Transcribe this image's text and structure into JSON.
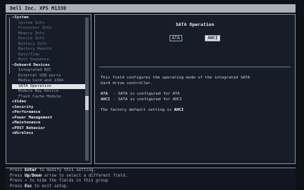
{
  "window": {
    "title": "Dell Inc. XPS M1330"
  },
  "menu": [
    {
      "label": "System",
      "kind": "cat"
    },
    {
      "label": "System Info",
      "kind": "sub"
    },
    {
      "label": "Processor Info",
      "kind": "sub"
    },
    {
      "label": "Memory Info",
      "kind": "sub"
    },
    {
      "label": "Device Info",
      "kind": "sub"
    },
    {
      "label": "Battery Info",
      "kind": "sub"
    },
    {
      "label": "Battery Health",
      "kind": "sub"
    },
    {
      "label": "Date/Time",
      "kind": "sub"
    },
    {
      "label": "Boot Sequence",
      "kind": "sub"
    },
    {
      "label": "Onboard Devices",
      "kind": "cat"
    },
    {
      "label": "Integrated NIC",
      "kind": "sub"
    },
    {
      "label": "External USB ports",
      "kind": "sub"
    },
    {
      "label": "Media Card and 1394",
      "kind": "sub"
    },
    {
      "label": "SATA Operation",
      "kind": "sub",
      "selected": true
    },
    {
      "label": "Module Bay Device",
      "kind": "sub"
    },
    {
      "label": "Flash Cache Module",
      "kind": "sub"
    },
    {
      "label": "Video",
      "kind": "cat"
    },
    {
      "label": "Security",
      "kind": "cat"
    },
    {
      "label": "Performance",
      "kind": "cat"
    },
    {
      "label": "Power Management",
      "kind": "cat"
    },
    {
      "label": "Maintenance",
      "kind": "cat"
    },
    {
      "label": "POST Behavior",
      "kind": "cat"
    },
    {
      "label": "Wireless",
      "kind": "cat"
    }
  ],
  "detail": {
    "title": "SATA Operation",
    "options": [
      {
        "label": "ATA",
        "active": false
      },
      {
        "label": "AHCI",
        "active": true
      }
    ],
    "description_line1": "This field configures the operating mode of the integrated SATA",
    "description_line2": "hard drive controller.",
    "modes": [
      {
        "key": "ATA",
        "text": "- SATA is configured for ATA"
      },
      {
        "key": "AHCI",
        "text": "- SATA is configured for AHCI"
      }
    ],
    "default_prefix": "The factory default setting is",
    "default_value": "AHCI"
  },
  "footer": [
    {
      "pre": "Press ",
      "key": "Enter",
      "post": " to modify this setting."
    },
    {
      "pre": "Press ",
      "key": "Up/Down",
      "post": " arrow to select a different field."
    },
    {
      "pre": "Press ",
      "key": "-",
      "post": " to hide the fields in this group"
    },
    {
      "pre": "Press ",
      "key": "Esc",
      "post": " to exit setup."
    }
  ]
}
